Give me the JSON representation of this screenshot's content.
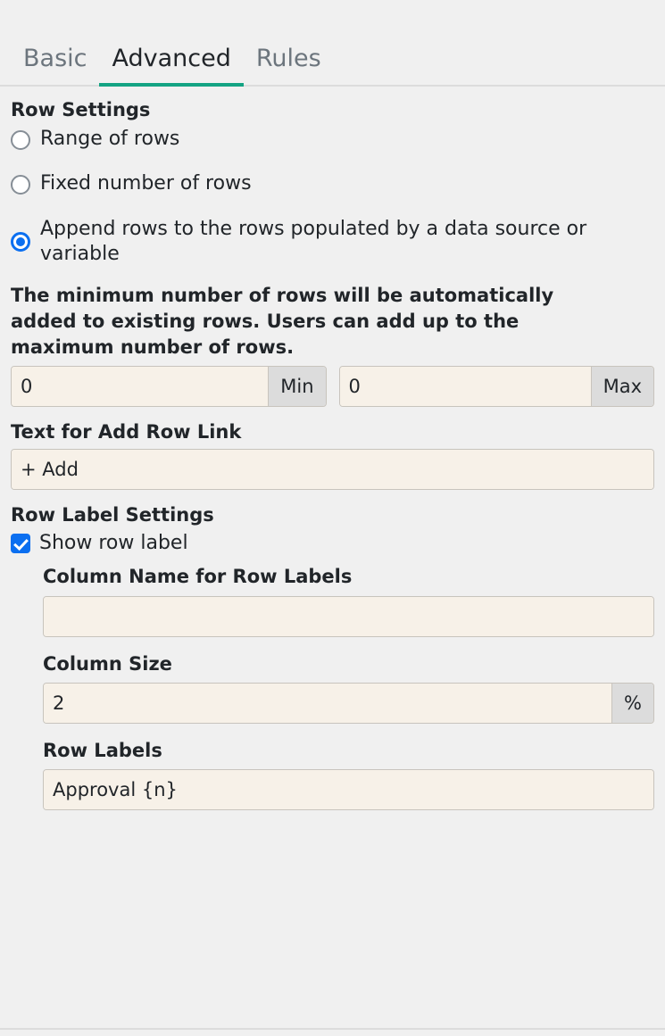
{
  "tabs": [
    {
      "label": "Basic",
      "active": false
    },
    {
      "label": "Advanced",
      "active": true
    },
    {
      "label": "Rules",
      "active": false
    }
  ],
  "row_settings": {
    "title": "Row Settings",
    "options": [
      {
        "label": "Range of rows",
        "selected": false
      },
      {
        "label": "Fixed number of rows",
        "selected": false
      },
      {
        "label": "Append rows to the rows populated by a data source or variable",
        "selected": true
      }
    ],
    "help_text": "The minimum number of rows will be automatically added to existing rows. Users can add up to the maximum number of rows.",
    "min": {
      "value": "0",
      "addon": "Min"
    },
    "max": {
      "value": "0",
      "addon": "Max"
    }
  },
  "add_row_link": {
    "label": "Text for Add Row Link",
    "value": "+ Add"
  },
  "row_label_settings": {
    "title": "Row Label Settings",
    "show_row_label": {
      "label": "Show row label",
      "checked": true
    },
    "column_name": {
      "label": "Column Name for Row Labels",
      "value": ""
    },
    "column_size": {
      "label": "Column Size",
      "value": "2",
      "addon": "%"
    },
    "row_labels": {
      "label": "Row Labels",
      "value": "Approval {n}"
    }
  },
  "colors": {
    "accent_tab": "#13a383",
    "accent_control": "#0b6ff0",
    "page_bg": "#f0f0f0",
    "input_bg": "#f7f1e8",
    "addon_bg": "#dcdcdc",
    "border": "#c8c4bd",
    "text": "#212529",
    "muted_text": "#6c757d"
  }
}
